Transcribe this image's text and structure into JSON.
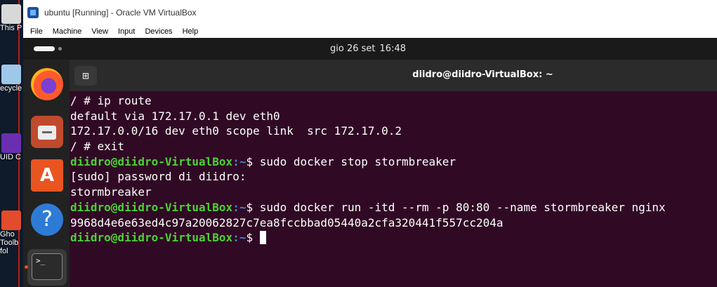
{
  "desktop": {
    "icons": [
      {
        "label": "This P"
      },
      {
        "label": "ecycle"
      },
      {
        "label": "UID C"
      },
      {
        "label": "Gho"
      },
      {
        "label": "Toolb"
      },
      {
        "label": "fol"
      }
    ],
    "colors": {
      "background": "#0f1a2a",
      "stripe": "#dd1122"
    }
  },
  "window": {
    "title": "ubuntu [Running] - Oracle VM VirtualBox",
    "menu": [
      "File",
      "Machine",
      "View",
      "Input",
      "Devices",
      "Help"
    ]
  },
  "ubuntu": {
    "clock": {
      "date": "gio 26 set",
      "time": "16:48"
    },
    "dock": [
      "firefox-icon",
      "files-icon",
      "app-center-icon",
      "help-icon",
      "terminal-icon"
    ]
  },
  "terminal": {
    "title": "diidro@diidro-VirtualBox: ~",
    "lines": [
      {
        "text": "/ # ip route"
      },
      {
        "text": "default via 172.17.0.1 dev eth0"
      },
      {
        "text": "172.17.0.0/16 dev eth0 scope link  src 172.17.0.2"
      },
      {
        "text": "/ # exit"
      },
      {
        "host": "diidro@diidro-VirtualBox",
        "path": ":~",
        "text": "$ sudo docker stop stormbreaker"
      },
      {
        "text": "[sudo] password di diidro:"
      },
      {
        "text": "stormbreaker"
      },
      {
        "host": "diidro@diidro-VirtualBox",
        "path": ":~",
        "text": "$ sudo docker run -itd --rm -p 80:80 --name stormbreaker nginx"
      },
      {
        "text": "9968d4e6e63ed4c97a20062827c7ea8fccbbad05440a2cfa320441f557cc204a"
      },
      {
        "host": "diidro@diidro-VirtualBox",
        "path": ":~",
        "text": "$ "
      }
    ],
    "colors": {
      "background": "#300a24",
      "host": "#4ad335",
      "path": "#4a84d6",
      "text": "#ffffff"
    }
  }
}
